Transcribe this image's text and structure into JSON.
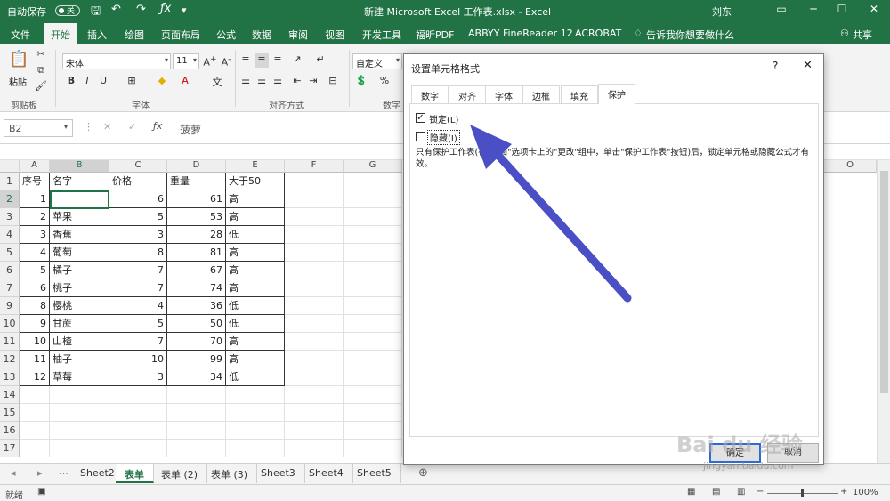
{
  "titlebar": {
    "autosave": "自动保存",
    "autosave_state": "关",
    "title": "新建 Microsoft Excel 工作表.xlsx - Excel",
    "user": "刘东"
  },
  "ribbon_tabs": [
    "文件",
    "开始",
    "插入",
    "绘图",
    "页面布局",
    "公式",
    "数据",
    "审阅",
    "视图",
    "开发工具",
    "福昕PDF",
    "ABBYY FineReader 12",
    "ACROBAT"
  ],
  "tell_me": "告诉我你想要做什么",
  "share": "共享",
  "ribbon": {
    "paste": "粘贴",
    "clipboard": "剪贴板",
    "font_name": "宋体",
    "font_size": "11",
    "font_group": "字体",
    "alignment_group": "对齐方式",
    "number_format": "自定义",
    "number_group": "数字"
  },
  "formula_bar": {
    "name_box": "B2",
    "content": "菠萝"
  },
  "columns": [
    "A",
    "B",
    "C",
    "D",
    "E",
    "F",
    "G",
    "O"
  ],
  "rows": [
    "1",
    "2",
    "3",
    "4",
    "5",
    "6",
    "7",
    "9",
    "10",
    "11",
    "12",
    "13",
    "14",
    "15",
    "16",
    "17"
  ],
  "table": {
    "headers": [
      "序号",
      "名字",
      "价格",
      "重量",
      "大于50"
    ],
    "rows": [
      [
        "1",
        "",
        "6",
        "61",
        "高"
      ],
      [
        "2",
        "苹果",
        "5",
        "53",
        "高"
      ],
      [
        "3",
        "香蕉",
        "3",
        "28",
        "低"
      ],
      [
        "4",
        "葡萄",
        "8",
        "81",
        "高"
      ],
      [
        "5",
        "橘子",
        "7",
        "67",
        "高"
      ],
      [
        "6",
        "桃子",
        "7",
        "74",
        "高"
      ],
      [
        "8",
        "樱桃",
        "4",
        "36",
        "低"
      ],
      [
        "9",
        "甘蔗",
        "5",
        "50",
        "低"
      ],
      [
        "10",
        "山楂",
        "7",
        "70",
        "高"
      ],
      [
        "11",
        "柚子",
        "10",
        "99",
        "高"
      ],
      [
        "12",
        "草莓",
        "3",
        "34",
        "低"
      ]
    ]
  },
  "sheet_tabs": [
    "Sheet2",
    "表单",
    "表单 (2)",
    "表单 (3)",
    "Sheet3",
    "Sheet4",
    "Sheet5"
  ],
  "active_sheet": "表单",
  "status": {
    "ready": "就绪",
    "zoom": "100%"
  },
  "dialog": {
    "title": "设置单元格格式",
    "help": "?",
    "tabs": [
      "数字",
      "对齐",
      "字体",
      "边框",
      "填充",
      "保护"
    ],
    "active_tab": "保护",
    "locked_label": "锁定(L)",
    "locked": true,
    "hidden_label": "隐藏(I)",
    "hidden": false,
    "note": "只有保护工作表(在\"审阅\"选项卡上的\"更改\"组中，单击\"保护工作表\"按钮)后，锁定单元格或隐藏公式才有效。",
    "ok": "确定",
    "cancel": "取消"
  },
  "watermark": {
    "brand": "Bai du 经验",
    "url": "jingyan.baidu.com"
  },
  "colors": {
    "excel_green": "#217346",
    "arrow": "#4a4fc6"
  }
}
